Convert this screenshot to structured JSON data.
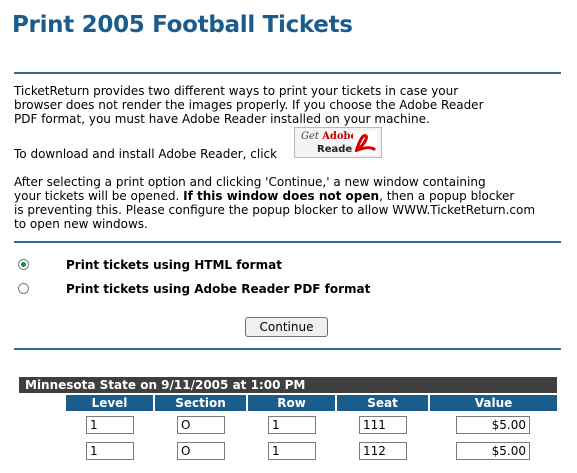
{
  "page": {
    "title": "Print 2005 Football Tickets"
  },
  "intro": {
    "line1": "TicketReturn provides two different ways to print your tickets in case your",
    "line2": "browser does not render the images properly. If you choose the Adobe Reader",
    "line3": "PDF format, you must have Adobe Reader installed on your machine.",
    "download_text": "To download and install Adobe Reader, click",
    "adobe_button": {
      "get": "Get",
      "brand": "Adobe",
      "product": "Reader"
    },
    "instr1": "After selecting a print option and clicking 'Continue,' a new window containing",
    "instr2a": "your tickets will be opened. ",
    "instr2b": "If this window does not open",
    "instr2c": ", then a popup blocker",
    "instr3": "is preventing this. Please configure the popup blocker to allow WWW.TicketReturn.com",
    "instr4": "to open new windows."
  },
  "options": [
    {
      "label": "Print tickets using HTML format",
      "checked": true
    },
    {
      "label": "Print tickets using Adobe Reader PDF format",
      "checked": false
    }
  ],
  "continue_label": "Continue",
  "event": {
    "title": "Minnesota State on 9/11/2005 at 1:00 PM",
    "columns": [
      "Level",
      "Section",
      "Row",
      "Seat",
      "Value"
    ],
    "rows": [
      [
        "1",
        "O",
        "1",
        "111",
        "$5.00"
      ],
      [
        "1",
        "O",
        "1",
        "112",
        "$5.00"
      ]
    ]
  },
  "colors": {
    "title": "#1a5c8c",
    "header_bar": "#1a5c8c",
    "event_bar": "#3f3f3f",
    "radio_selected": "#1f8a3b"
  }
}
